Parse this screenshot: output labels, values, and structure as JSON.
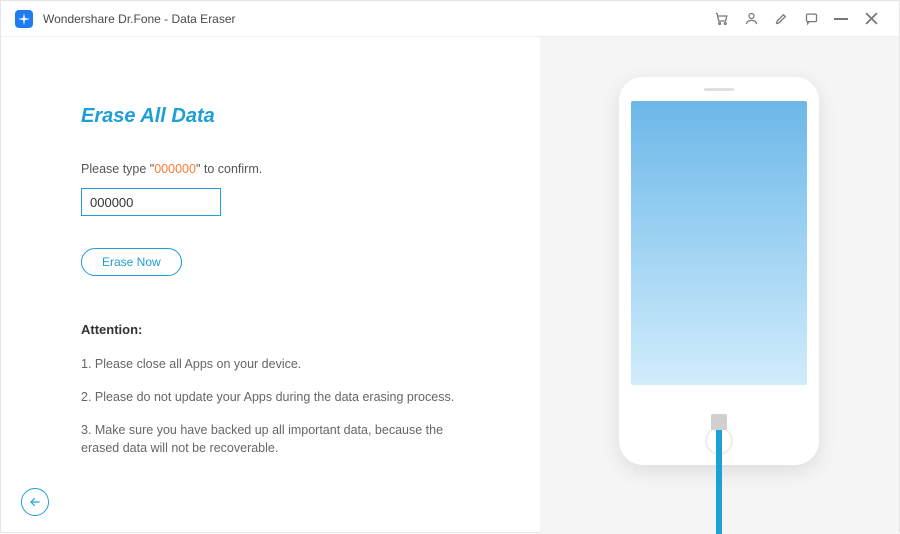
{
  "titlebar": {
    "title": "Wondershare Dr.Fone - Data Eraser"
  },
  "main": {
    "heading": "Erase All Data",
    "confirm_prefix": "Please type \"",
    "confirm_code": "000000",
    "confirm_suffix": "\" to confirm.",
    "input_value": "000000",
    "erase_button": "Erase Now",
    "attention_heading": "Attention:",
    "attention_items": [
      "1. Please close all Apps on your device.",
      "2. Please do not update your Apps during the data erasing process.",
      "3. Make sure you have backed up all important data, because the erased data will not be recoverable."
    ]
  }
}
